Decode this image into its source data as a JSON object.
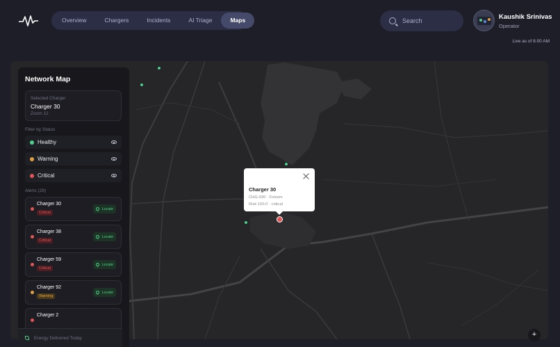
{
  "header": {
    "nav": [
      {
        "label": "Overview",
        "active": false
      },
      {
        "label": "Chargers",
        "active": false
      },
      {
        "label": "Incidents",
        "active": false
      },
      {
        "label": "AI Triage",
        "active": false
      },
      {
        "label": "Maps",
        "active": true
      }
    ],
    "search_placeholder": "Search",
    "user_name": "Kaushik Srinivas",
    "user_role": "Operator",
    "live_text": "Live as of 8:00 AM"
  },
  "panel": {
    "title": "Network Map",
    "selected_label": "Selected Charger",
    "selected_value": "Charger 30",
    "zoom_text": "Zoom 12",
    "filter_label": "Filter by Status",
    "filters": [
      {
        "label": "Healthy",
        "color": "#4fd18b"
      },
      {
        "label": "Warning",
        "color": "#e0a040"
      },
      {
        "label": "Critical",
        "color": "#e25555"
      }
    ],
    "alerts_label": "Alerts (29)",
    "locate_label": "Locate",
    "alerts": [
      {
        "name": "Charger 30",
        "status": "Critical"
      },
      {
        "name": "Charger 38",
        "status": "Critical"
      },
      {
        "name": "Charger 59",
        "status": "Critical"
      },
      {
        "name": "Charger 92",
        "status": "Warning"
      },
      {
        "name": "Charger 2",
        "status": ""
      }
    ],
    "energy_label": "Energy Delivered Today"
  },
  "popup": {
    "title": "Charger 30",
    "subtitle": "CHG-030 · Folsom",
    "risk": "Risk 100.0 · critical"
  },
  "map": {
    "zoom_in_label": "+"
  },
  "colors": {
    "healthy": "#4fd18b",
    "warning": "#e0a040",
    "critical": "#e25555",
    "accent": "#464a6a"
  }
}
